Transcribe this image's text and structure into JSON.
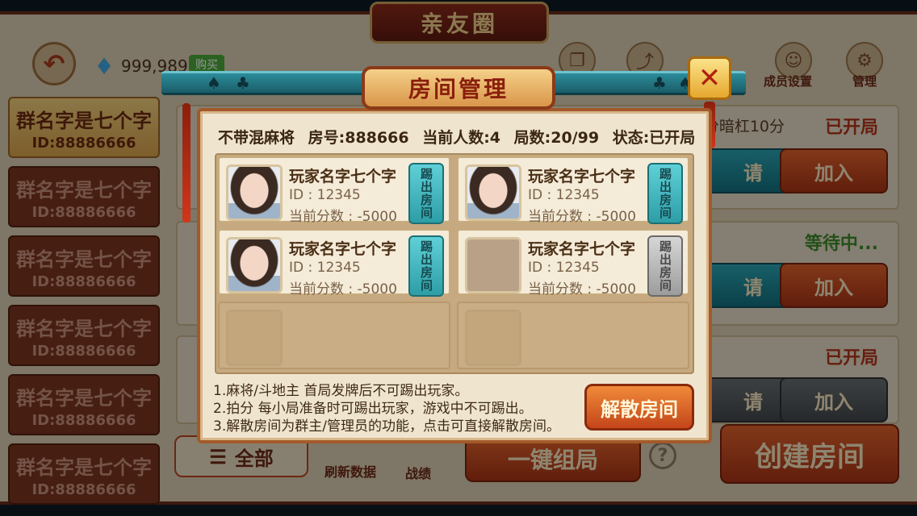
{
  "header": {
    "title": "亲友圈",
    "diamond_count": "999,989",
    "buy_label": "购买",
    "icons": [
      {
        "name": "copy-icon",
        "glyph": "❐",
        "label": ""
      },
      {
        "name": "share-icon",
        "glyph": "⤴",
        "label": ""
      },
      {
        "name": "member-icon",
        "glyph": "👤",
        "label": "成员设置"
      },
      {
        "name": "manage-icon",
        "glyph": "⚙",
        "label": "管理"
      }
    ]
  },
  "groups": [
    {
      "name": "群名字是七个字",
      "id": "ID:88886666",
      "active": true
    },
    {
      "name": "群名字是七个字",
      "id": "ID:88886666",
      "active": false
    },
    {
      "name": "群名字是七个字",
      "id": "ID:88886666",
      "active": false
    },
    {
      "name": "群名字是七个字",
      "id": "ID:88886666",
      "active": false
    },
    {
      "name": "群名字是七个字",
      "id": "ID:88886666",
      "active": false
    },
    {
      "name": "群名字是七个字",
      "id": "ID:88886666",
      "active": false
    }
  ],
  "rooms": [
    {
      "rule_fragment": "分暗杠10分",
      "status": "已开局",
      "status_color": "#b0341a",
      "invite_label": "请",
      "join_label": "加入"
    },
    {
      "rule_fragment": "",
      "status": "等待中...",
      "status_color": "#3c8a2a",
      "invite_label": "请",
      "join_label": "加入"
    },
    {
      "rule_fragment": "",
      "status": "已开局",
      "status_color": "#b0341a",
      "invite_label": "请",
      "join_label": "加入"
    }
  ],
  "bottom": {
    "all_label": "全部",
    "refresh_label": "刷新数据",
    "record_label": "战绩",
    "quick_label": "一键组局",
    "create_label": "创建房间"
  },
  "modal": {
    "title": "房间管理",
    "close_glyph": "✕",
    "info": {
      "rule": "不带混麻将",
      "room_no": "房号:888666",
      "players": "当前人数:4",
      "rounds": "局数:20/99",
      "status": "状态:已开局"
    },
    "players": [
      {
        "name": "玩家名字七个字",
        "id": "ID : 12345",
        "score": "当前分数 : -5000",
        "kick_label": "踢出房间",
        "has_avatar": true,
        "kick_enabled": true
      },
      {
        "name": "玩家名字七个字",
        "id": "ID : 12345",
        "score": "当前分数 : -5000",
        "kick_label": "踢出房间",
        "has_avatar": true,
        "kick_enabled": true
      },
      {
        "name": "玩家名字七个字",
        "id": "ID : 12345",
        "score": "当前分数 : -5000",
        "kick_label": "踢出房间",
        "has_avatar": true,
        "kick_enabled": true
      },
      {
        "name": "玩家名字七个字",
        "id": "ID : 12345",
        "score": "当前分数 : -5000",
        "kick_label": "踢出房间",
        "has_avatar": false,
        "kick_enabled": false
      }
    ],
    "notes": [
      "1.麻将/斗地主 首局发牌后不可踢出玩家。",
      "2.拍分 每小局准备时可踢出玩家，游戏中不可踢出。",
      "3.解散房间为群主/管理员的功能，点击可直接解散房间。"
    ],
    "dissolve_label": "解散房间"
  },
  "colors": {
    "accent_red": "#8a1f0c",
    "teal": "#2e9ea6",
    "gold": "#f1ce7c"
  }
}
